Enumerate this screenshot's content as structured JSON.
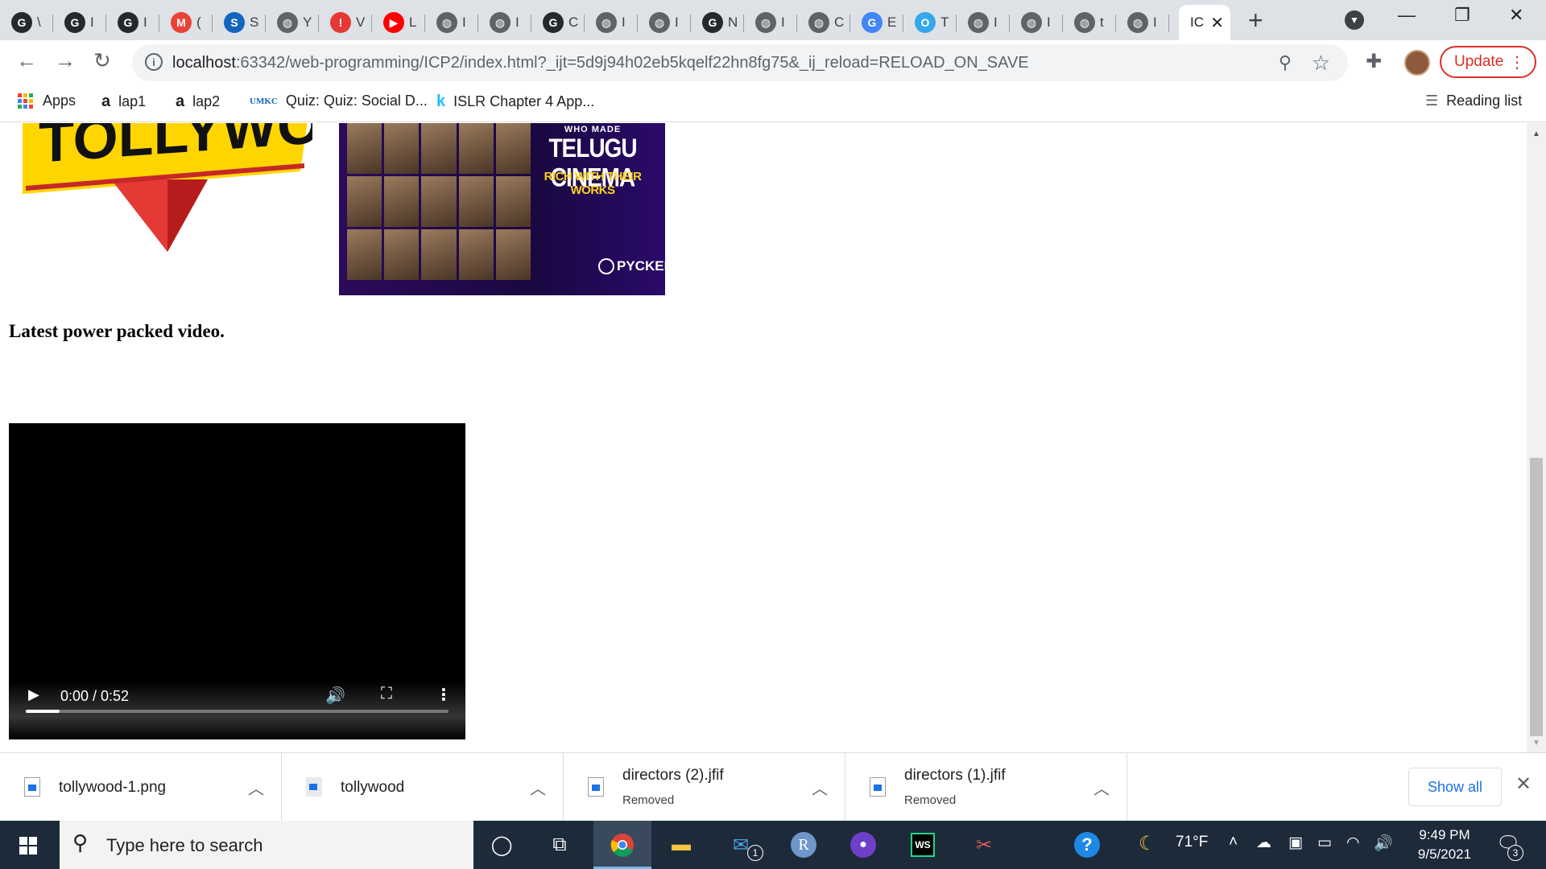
{
  "browser": {
    "tabs": [
      {
        "label": "G",
        "favicon_color": "#24292e",
        "icon": "github-icon",
        "title_hint": "\\"
      },
      {
        "label": "G",
        "favicon_color": "#24292e",
        "icon": "github-icon",
        "title_hint": "I"
      },
      {
        "label": "G",
        "favicon_color": "#24292e",
        "icon": "github-icon",
        "title_hint": "I"
      },
      {
        "label": "M",
        "favicon_color": "#ea4335",
        "icon": "gmail-icon",
        "title_hint": "("
      },
      {
        "label": "S",
        "favicon_color": "#1565c0",
        "icon": "survey-icon",
        "title_hint": "S"
      },
      {
        "label": "◍",
        "favicon_color": "#5f6368",
        "icon": "globe-icon",
        "title_hint": "Y"
      },
      {
        "label": "!",
        "favicon_color": "#e53935",
        "icon": "alert-icon",
        "title_hint": "V"
      },
      {
        "label": "▶",
        "favicon_color": "#ff0000",
        "icon": "youtube-icon",
        "title_hint": "L"
      },
      {
        "label": "◍",
        "favicon_color": "#5f6368",
        "icon": "globe-icon",
        "title_hint": "I"
      },
      {
        "label": "◍",
        "favicon_color": "#5f6368",
        "icon": "globe-icon",
        "title_hint": "I"
      },
      {
        "label": "G",
        "favicon_color": "#24292e",
        "icon": "github-icon",
        "title_hint": "C"
      },
      {
        "label": "◍",
        "favicon_color": "#5f6368",
        "icon": "globe-icon",
        "title_hint": "I"
      },
      {
        "label": "◍",
        "favicon_color": "#5f6368",
        "icon": "globe-icon",
        "title_hint": "I"
      },
      {
        "label": "G",
        "favicon_color": "#24292e",
        "icon": "github-icon",
        "title_hint": "N"
      },
      {
        "label": "◍",
        "favicon_color": "#5f6368",
        "icon": "globe-icon",
        "title_hint": "I"
      },
      {
        "label": "◍",
        "favicon_color": "#5f6368",
        "icon": "globe-icon",
        "title_hint": "C"
      },
      {
        "label": "G",
        "favicon_color": "#4285f4",
        "icon": "google-icon",
        "title_hint": "E"
      },
      {
        "label": "O",
        "favicon_color": "#34a8eb",
        "icon": "circle-icon",
        "title_hint": "T"
      },
      {
        "label": "◍",
        "favicon_color": "#5f6368",
        "icon": "globe-icon",
        "title_hint": "I"
      },
      {
        "label": "◍",
        "favicon_color": "#5f6368",
        "icon": "globe-icon",
        "title_hint": "I"
      },
      {
        "label": "◍",
        "favicon_color": "#5f6368",
        "icon": "globe-icon",
        "title_hint": "t"
      },
      {
        "label": "◍",
        "favicon_color": "#5f6368",
        "icon": "globe-icon",
        "title_hint": "I"
      }
    ],
    "active_tab": {
      "title_hint": "IC"
    },
    "url": {
      "host": "localhost",
      "path": ":63342/web-programming/ICP2/index.html?_ijt=5d9j94h02eb5kqelf22hn8fg75&_ij_reload=RELOAD_ON_SAVE"
    },
    "update_label": "Update",
    "bookmarks": [
      {
        "label": "Apps",
        "icon": "apps-icon"
      },
      {
        "label": "lap1",
        "icon": "amazon-icon",
        "glyph": "a"
      },
      {
        "label": "lap2",
        "icon": "amazon-icon",
        "glyph": "a"
      },
      {
        "label": "Quiz: Quiz: Social D...",
        "icon": "umkc-icon",
        "glyph": "UMKC"
      },
      {
        "label": "ISLR Chapter 4 App...",
        "icon": "kaggle-icon",
        "glyph": "k"
      }
    ],
    "reading_list": "Reading list"
  },
  "page": {
    "tollywood_logo_text": "TOLLYWOOD",
    "poster": {
      "line1": "WHO MADE",
      "line2": "TELUGU CINEMA",
      "line3": "RICH WITH THEIR WORKS",
      "brand": "PYCKER"
    },
    "heading": "Latest power packed video.",
    "video": {
      "time": "0:00 / 0:52",
      "progress": 0.08
    },
    "scroll_position": 0.56
  },
  "downloads": {
    "items": [
      {
        "name": "tollywood-1.png",
        "status": ""
      },
      {
        "name": "tollywood",
        "status": ""
      },
      {
        "name": "directors (2).jfif",
        "status": "Removed"
      },
      {
        "name": "directors (1).jfif",
        "status": "Removed"
      }
    ],
    "show_all": "Show all"
  },
  "taskbar": {
    "search_placeholder": "Type here to search",
    "mail_badge": "1",
    "weather": "71°F",
    "time": "9:49 PM",
    "date": "9/5/2021",
    "notification_count": "3"
  }
}
